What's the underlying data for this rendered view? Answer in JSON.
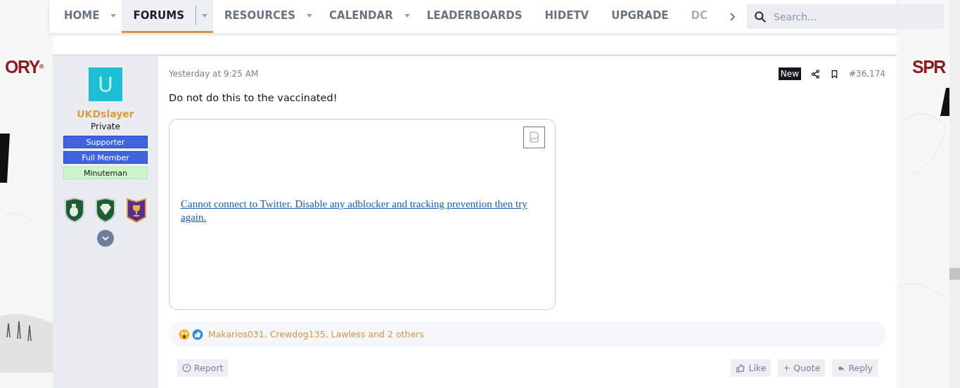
{
  "nav": {
    "items": [
      {
        "label": "HOME",
        "has_menu": true,
        "selected": false
      },
      {
        "label": "FORUMS",
        "has_menu": true,
        "selected": true
      },
      {
        "label": "RESOURCES",
        "has_menu": true,
        "selected": false
      },
      {
        "label": "CALENDAR",
        "has_menu": true,
        "selected": false
      },
      {
        "label": "LEADERBOARDS",
        "has_menu": false,
        "selected": false
      },
      {
        "label": "HIDETV",
        "has_menu": false,
        "selected": false
      },
      {
        "label": "UPGRADE",
        "has_menu": false,
        "selected": false
      },
      {
        "label": "DC",
        "has_menu": false,
        "selected": false,
        "faded": true
      }
    ],
    "search": {
      "placeholder": "Search..."
    }
  },
  "side_ads": {
    "left": "ORY",
    "left_mark": "®",
    "right": "SPR"
  },
  "post": {
    "author": {
      "initial": "U",
      "name": "UKDslayer",
      "rank": "Private",
      "banners": [
        {
          "label": "Supporter",
          "kind": "blue"
        },
        {
          "label": "Full Member",
          "kind": "blue"
        },
        {
          "label": "Minuteman",
          "kind": "green"
        }
      ],
      "trophies": [
        {
          "kind": "grenade"
        },
        {
          "kind": "diamond"
        },
        {
          "kind": "cup"
        }
      ]
    },
    "time": "Yesterday at 9:25 AM",
    "badge": "New",
    "number": "#36,174",
    "text": "Do not do this to the vaccinated!",
    "embed_link": "Cannot connect to Twitter. Disable any adblocker and tracking prevention then try again.",
    "reactions": "Makarios031, Crewdog135, Lawless and 2 others",
    "actions": {
      "report": "Report",
      "like": "Like",
      "quote": "Quote",
      "reply": "Reply"
    }
  }
}
